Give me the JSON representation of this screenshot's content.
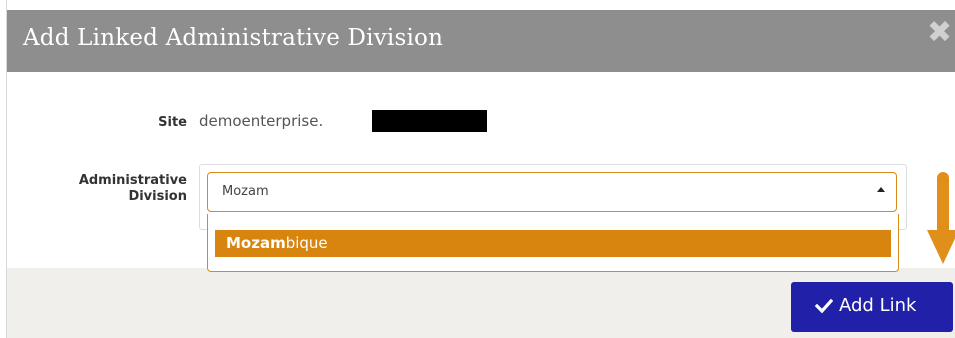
{
  "modal": {
    "title": "Add Linked Administrative Division",
    "close_icon": "✖"
  },
  "form": {
    "site_label": "Site",
    "site_value": "demoenterprise.",
    "division_label_line1": "Administrative",
    "division_label_line2": "Division",
    "division_input_value": "Mozam"
  },
  "dropdown": {
    "option_match": "Mozam",
    "option_rest": "bique"
  },
  "footer": {
    "add_link_label": "Add Link"
  },
  "colors": {
    "header": "#8e8e8e",
    "accent": "#d8850f",
    "button": "#2020a8",
    "footer": "#f1efec"
  },
  "icons": {
    "close": "close-icon",
    "caret": "caret-up-icon",
    "check": "check-icon",
    "arrow": "arrow-down-icon"
  }
}
